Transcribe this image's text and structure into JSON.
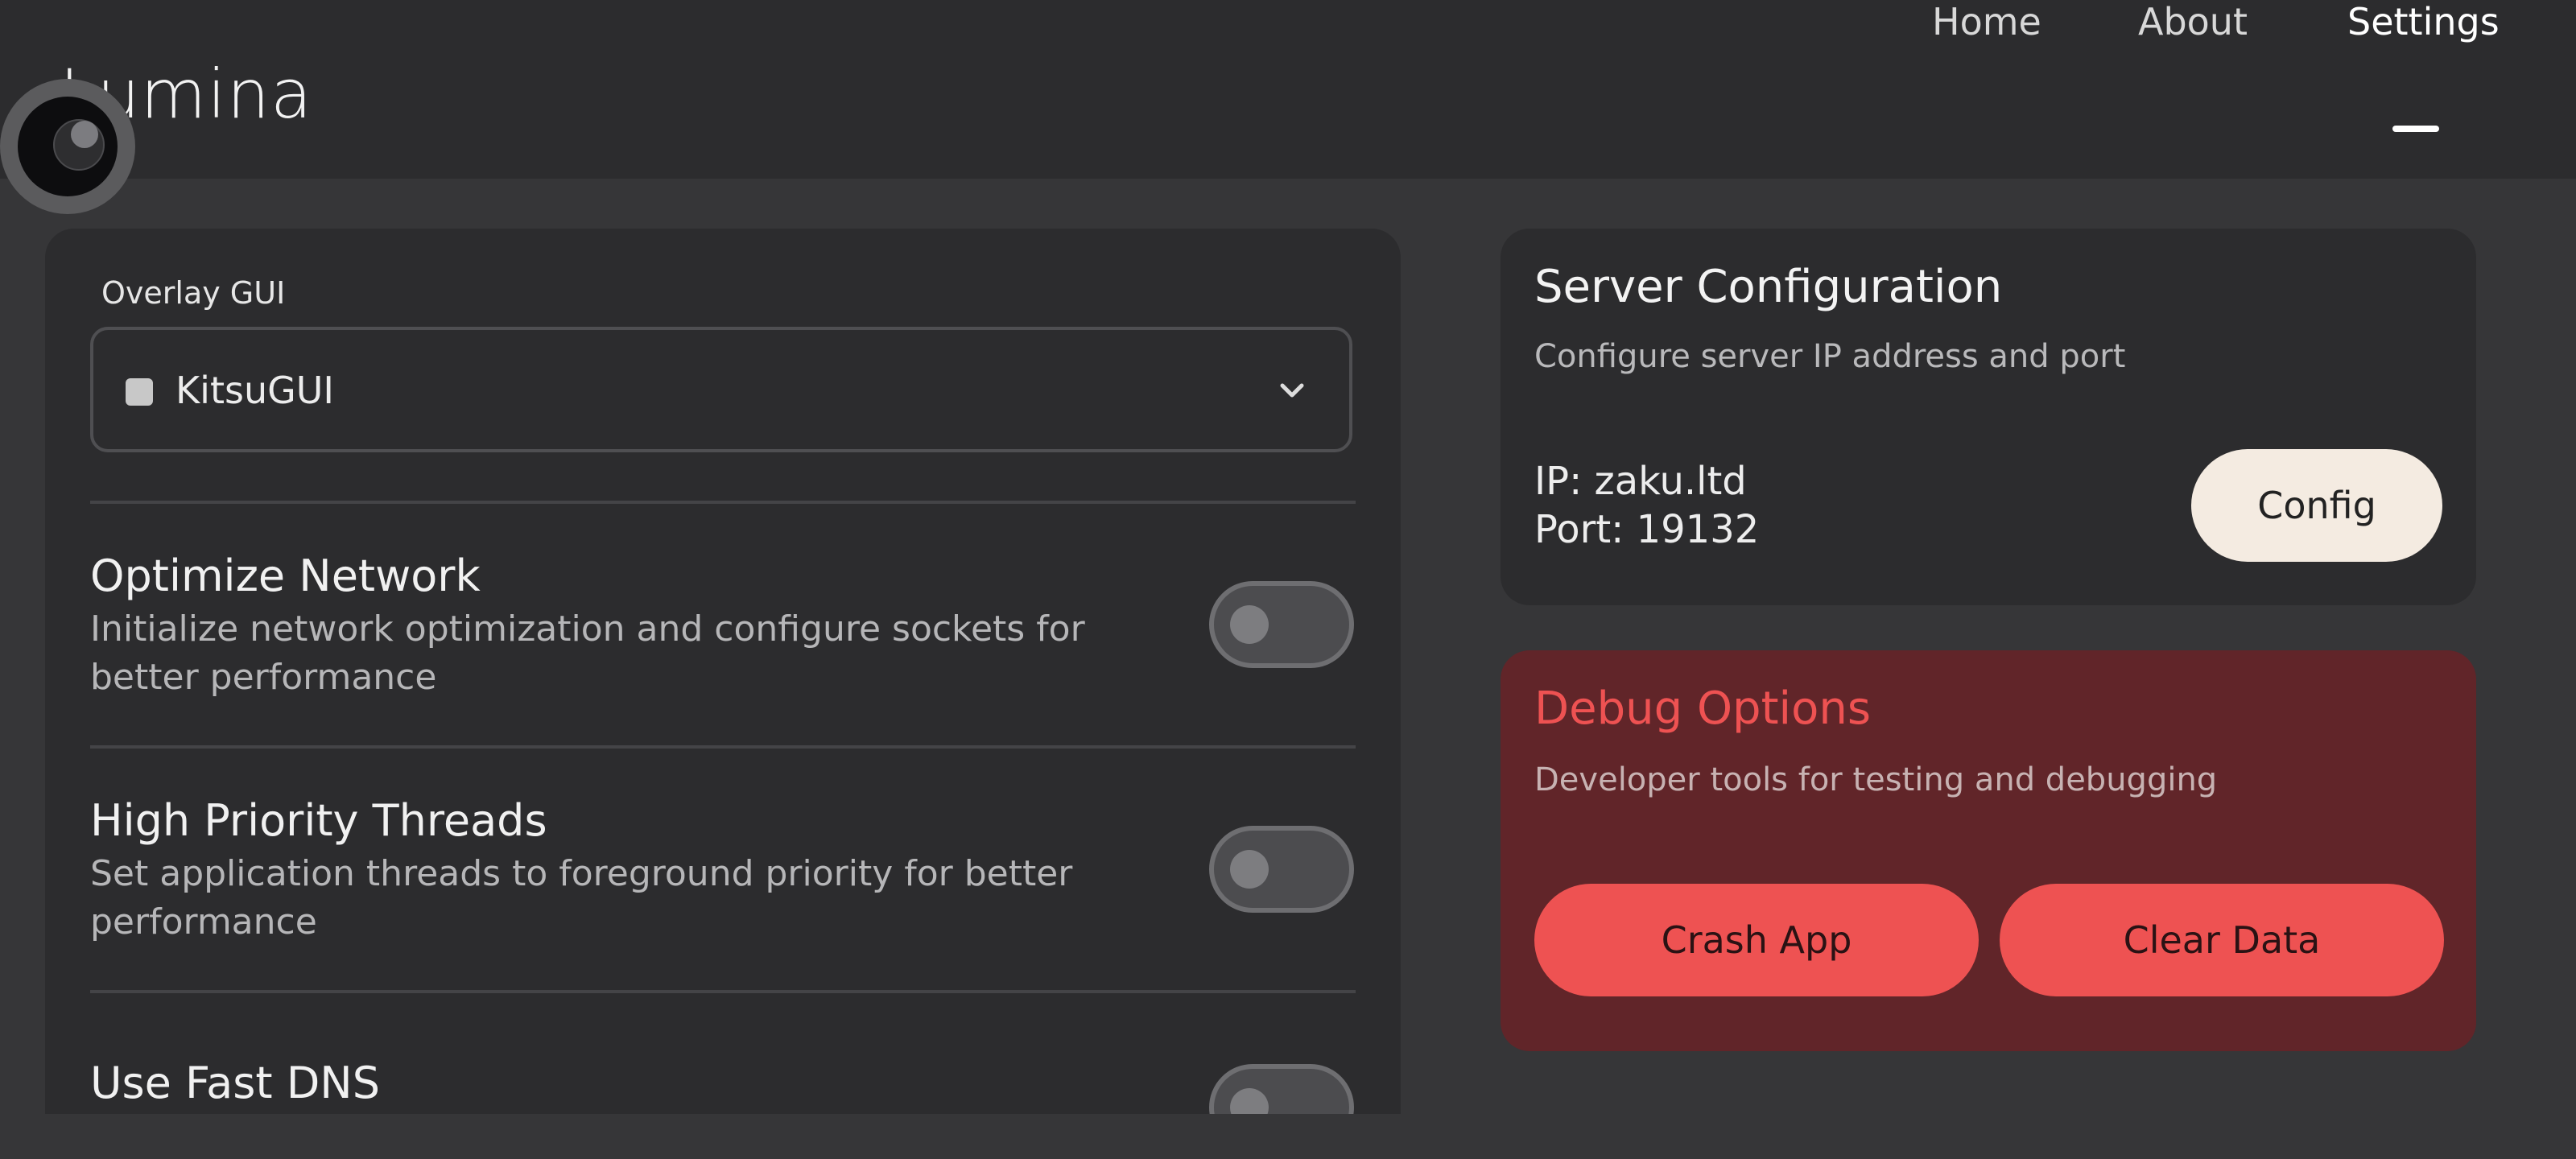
{
  "app": {
    "title": "Lumina"
  },
  "nav": {
    "items": [
      "Home",
      "About",
      "Settings"
    ],
    "active": "Settings"
  },
  "overlay": {
    "label": "Overlay GUI",
    "selected": "KitsuGUI"
  },
  "options": [
    {
      "title": "Optimize Network",
      "desc": "Initialize network optimization and configure sockets for better performance",
      "enabled": false
    },
    {
      "title": "High Priority Threads",
      "desc": "Set application threads to foreground priority for better performance",
      "enabled": false
    },
    {
      "title": "Use Fast DNS",
      "desc": "",
      "enabled": false
    }
  ],
  "server": {
    "title": "Server Configuration",
    "subtitle": "Configure server IP address and port",
    "ip": "IP: zaku.ltd",
    "port": "Port: 19132",
    "button": "Config"
  },
  "debug": {
    "title": "Debug Options",
    "subtitle": "Developer tools for testing and debugging",
    "crash_button": "Crash App",
    "clear_button": "Clear Data"
  },
  "icons": {
    "dropdown": "chevron-down-icon",
    "logo": "lumina-logo-icon"
  },
  "colors": {
    "accent_danger": "#ee5252",
    "debug_bg": "#612529",
    "config_btn": "#f4ebe1"
  }
}
